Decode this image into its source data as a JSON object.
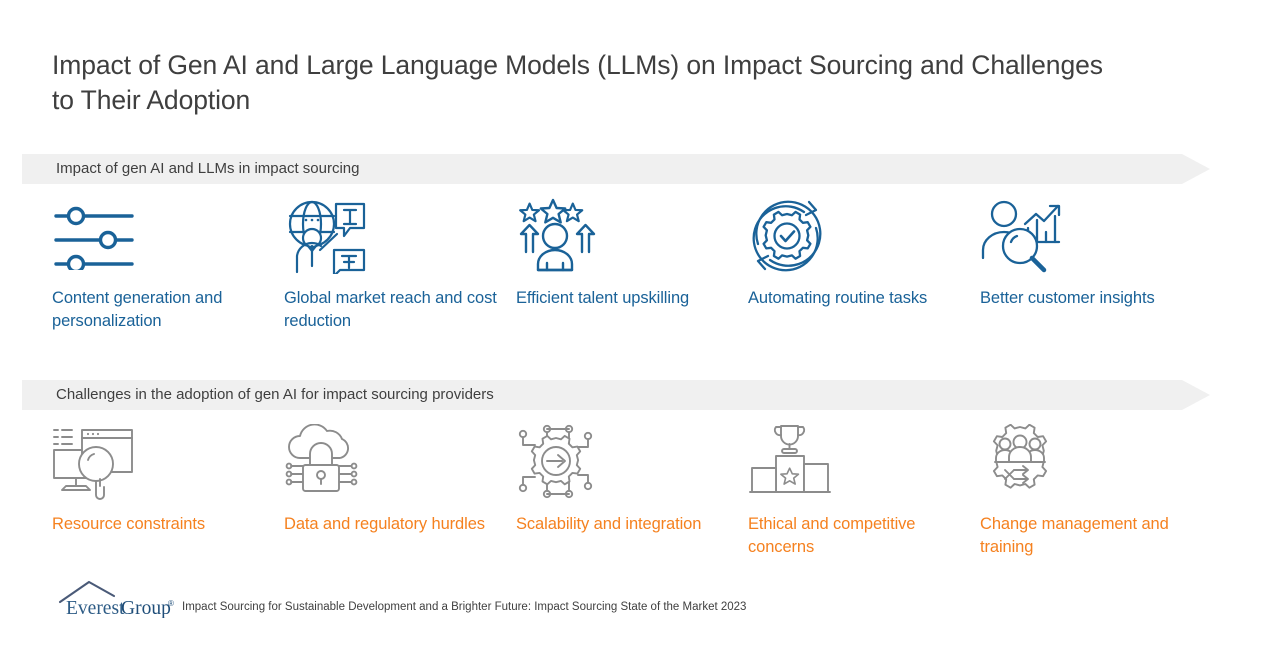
{
  "title": "Impact of Gen AI and Large Language Models (LLMs) on Impact Sourcing and Challenges to Their Adoption",
  "colors": {
    "blue": "#1a6298",
    "orange": "#f5811f",
    "band_bg": "#f0f0f0",
    "title_text": "#3f3f3f",
    "icon_gray": "#8c8c8c",
    "logo_navy": "#1f3864",
    "logo_blue": "#2e6da4"
  },
  "sections": [
    {
      "banner": "Impact of gen AI and LLMs in impact sourcing",
      "accent": "blue",
      "cards": [
        {
          "icon": "sliders-icon",
          "label": "Content generation and personalization"
        },
        {
          "icon": "global-translation-icon",
          "label": "Global market reach and cost reduction"
        },
        {
          "icon": "person-stars-upskilling-icon",
          "label": "Efficient talent upskilling"
        },
        {
          "icon": "gear-check-automation-icon",
          "label": "Automating routine tasks"
        },
        {
          "icon": "customer-analytics-magnifier-icon",
          "label": "Better customer insights"
        }
      ]
    },
    {
      "banner": "Challenges in the adoption of gen AI for impact sourcing providers",
      "accent": "orange",
      "cards": [
        {
          "icon": "monitor-magnifier-icon",
          "label": "Resource constraints"
        },
        {
          "icon": "cloud-lock-icon",
          "label": "Data and regulatory hurdles"
        },
        {
          "icon": "gear-arrow-network-icon",
          "label": "Scalability and integration"
        },
        {
          "icon": "podium-trophy-icon",
          "label": "Ethical and competitive concerns"
        },
        {
          "icon": "gear-people-shuffle-icon",
          "label": "Change management and training"
        }
      ]
    }
  ],
  "footer": {
    "logo_text": "Everest Group",
    "logo_mark": "mountain-peak-icon",
    "registered_symbol": "®",
    "source": "Impact Sourcing for Sustainable Development and a Brighter Future: Impact Sourcing State of the Market 2023"
  }
}
